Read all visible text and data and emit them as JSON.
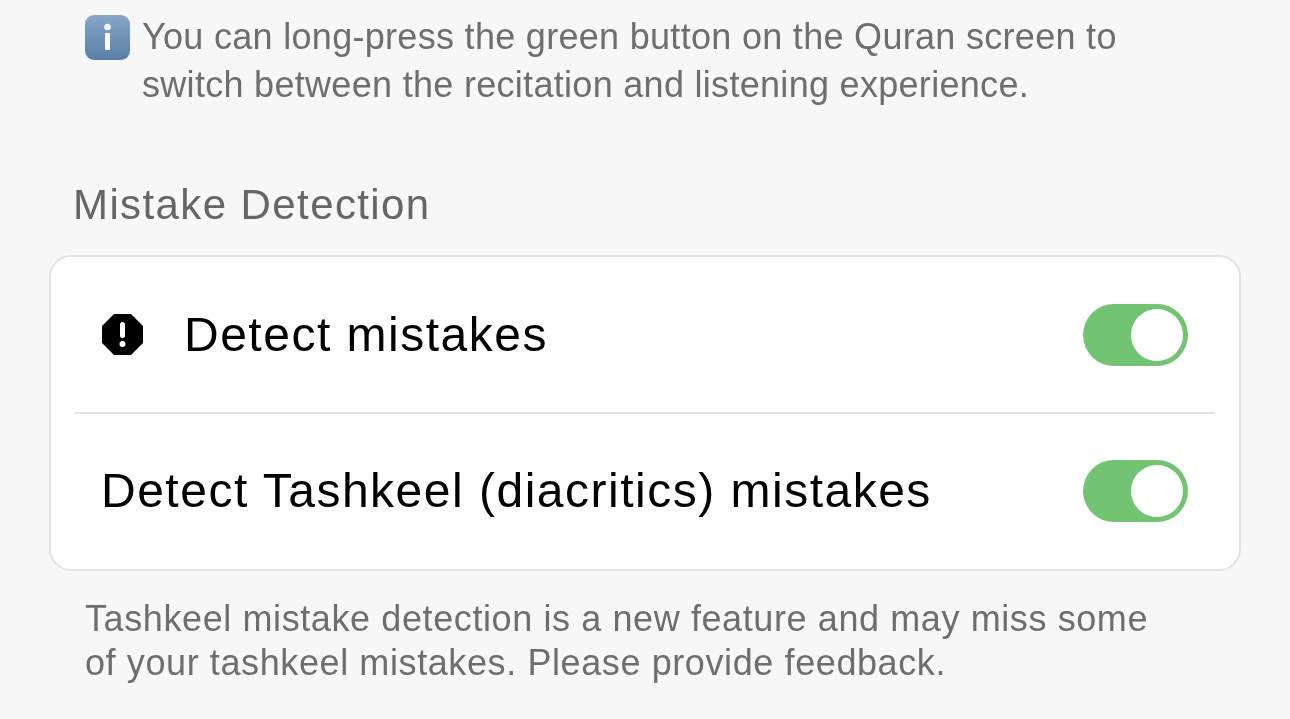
{
  "info_note": {
    "text": "You can long-press the green button on the Quran screen to switch between the recitation and listening experience."
  },
  "section": {
    "title": "Mistake Detection",
    "rows": [
      {
        "kind": "icon",
        "label": "Detect mistakes",
        "on": true
      },
      {
        "kind": "plain",
        "label": "Detect Tashkeel (diacritics) mistakes",
        "on": true
      }
    ],
    "footer": "Tashkeel mistake detection is a new feature and may miss some of your tashkeel mistakes. Please provide feedback."
  }
}
